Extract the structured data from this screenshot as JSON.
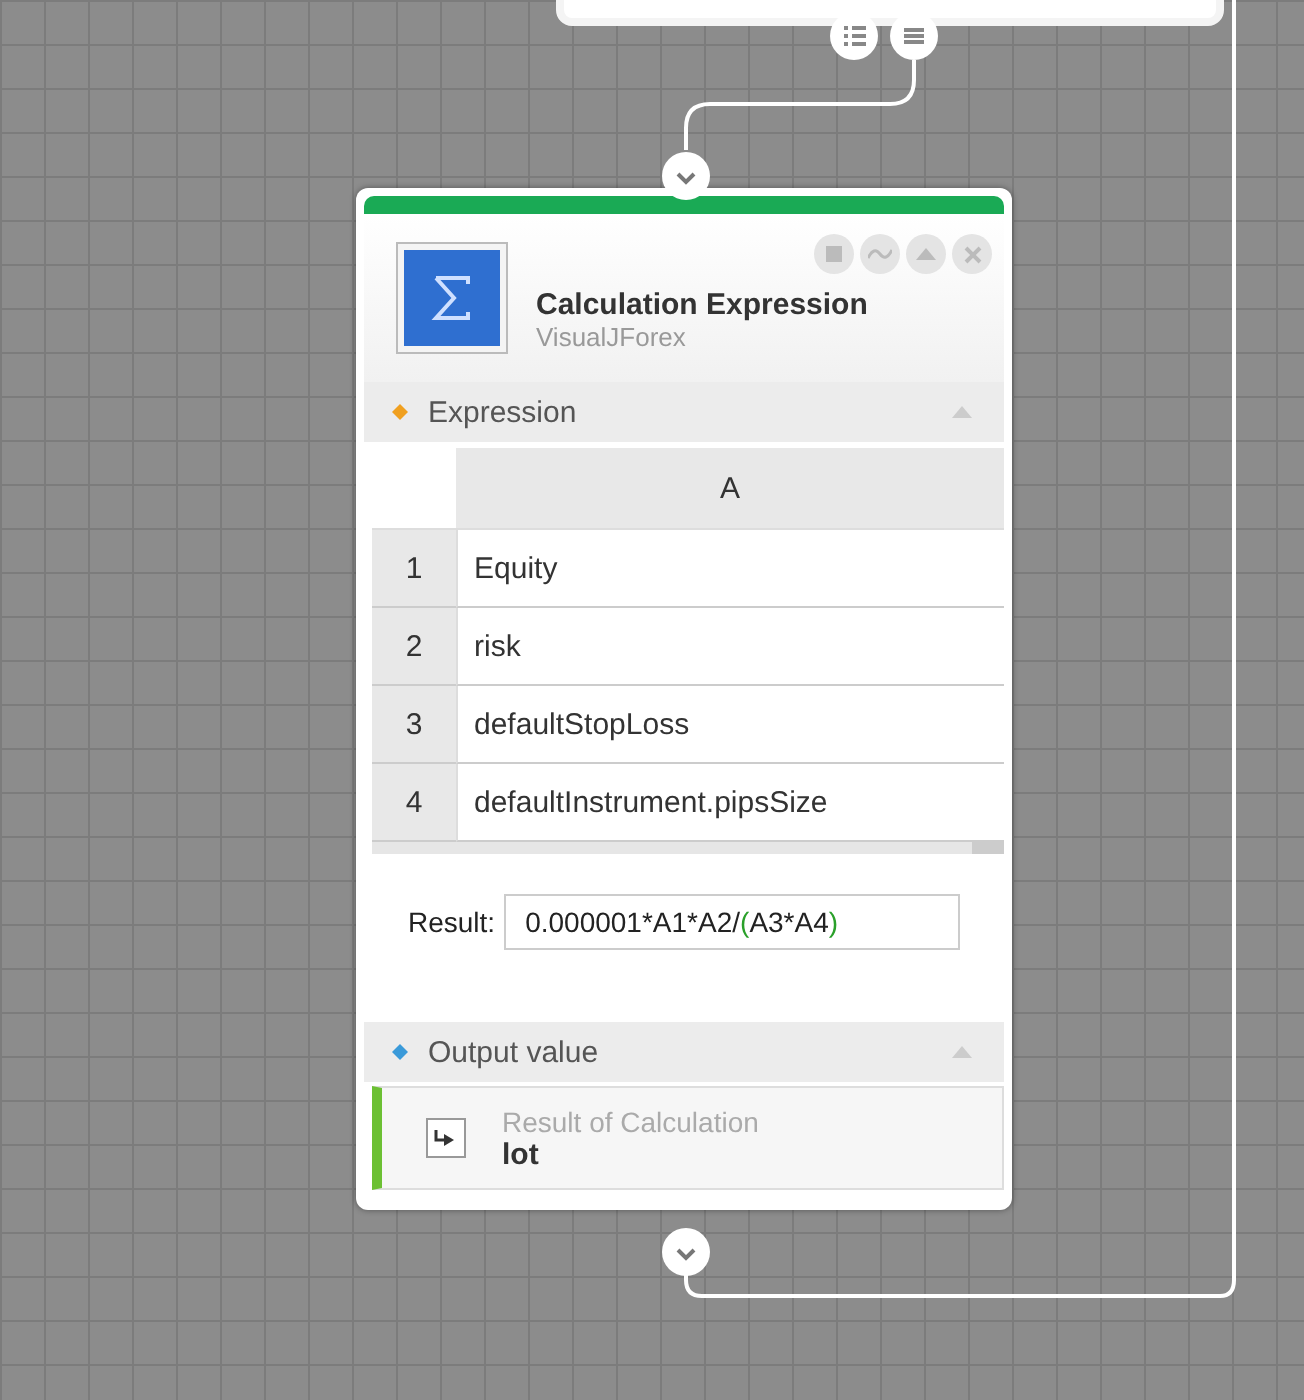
{
  "node": {
    "title": "Calculation Expression",
    "subtitle": "VisualJForex",
    "sections": [
      {
        "kind": "table",
        "title": "Expression",
        "columns": [
          "A"
        ],
        "rows": [
          {
            "index": "1",
            "value": "Equity"
          },
          {
            "index": "2",
            "value": "risk"
          },
          {
            "index": "3",
            "value": "defaultStopLoss"
          },
          {
            "index": "4",
            "value": "defaultInstrument.pipsSize"
          }
        ],
        "result_label": "Result:",
        "result_parts": [
          {
            "text": "0.000001*A1*A2/",
            "highlight": false
          },
          {
            "text": "(",
            "highlight": true
          },
          {
            "text": "A3*A4",
            "highlight": false
          },
          {
            "text": ")",
            "highlight": true
          }
        ]
      },
      {
        "kind": "output",
        "title": "Output value",
        "label": "Result of Calculation",
        "value": "lot"
      }
    ]
  }
}
